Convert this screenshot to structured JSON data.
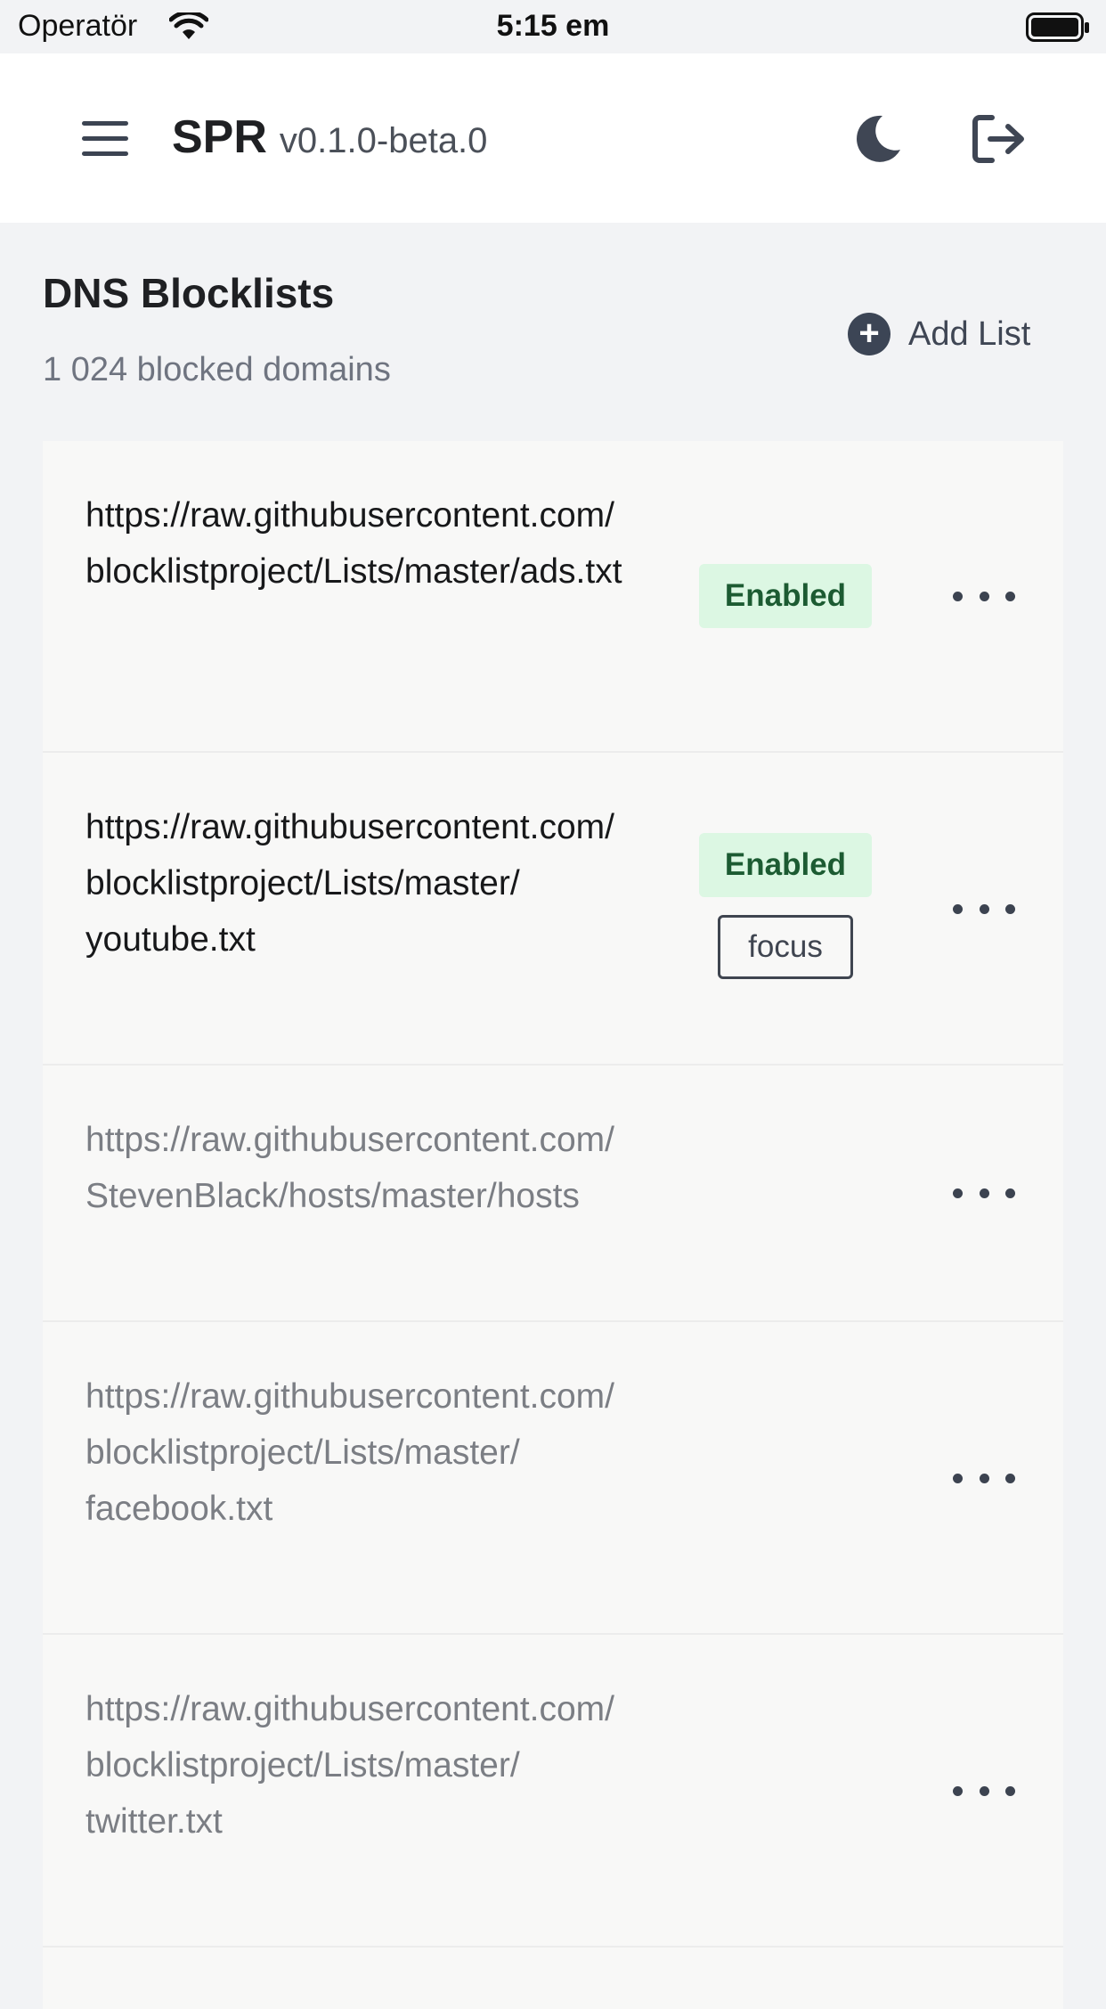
{
  "status_bar": {
    "carrier": "Operatör",
    "time": "5:15 em"
  },
  "header": {
    "brand": "SPR",
    "version": "v0.1.0-beta.0",
    "icons": [
      "menu-icon",
      "moon-icon",
      "logout-icon"
    ]
  },
  "page": {
    "title": "DNS Blocklists",
    "subtitle": "1 024 blocked domains",
    "add_button_label": "Add List",
    "add_icon": "plus-circle-icon"
  },
  "lists": [
    {
      "url": "https://raw.githubusercontent.com/blocklistproject/Lists/master/ads.txt",
      "status": "Enabled",
      "tags": [],
      "enabled": true
    },
    {
      "url": "https://raw.githubusercontent.com/blocklistproject/Lists/master/youtube.txt",
      "status": "Enabled",
      "tags": [
        "focus"
      ],
      "enabled": true
    },
    {
      "url": "https://raw.githubusercontent.com/StevenBlack/hosts/master/hosts",
      "status": "",
      "tags": [],
      "enabled": false
    },
    {
      "url": "https://raw.githubusercontent.com/blocklistproject/Lists/master/facebook.txt",
      "status": "",
      "tags": [],
      "enabled": false
    },
    {
      "url": "https://raw.githubusercontent.com/blocklistproject/Lists/master/twitter.txt",
      "status": "",
      "tags": [],
      "enabled": false
    }
  ],
  "colors": {
    "accent_dark": "#3c4555",
    "enabled_bg": "#dcf7e3",
    "enabled_text": "#1c5b32"
  }
}
